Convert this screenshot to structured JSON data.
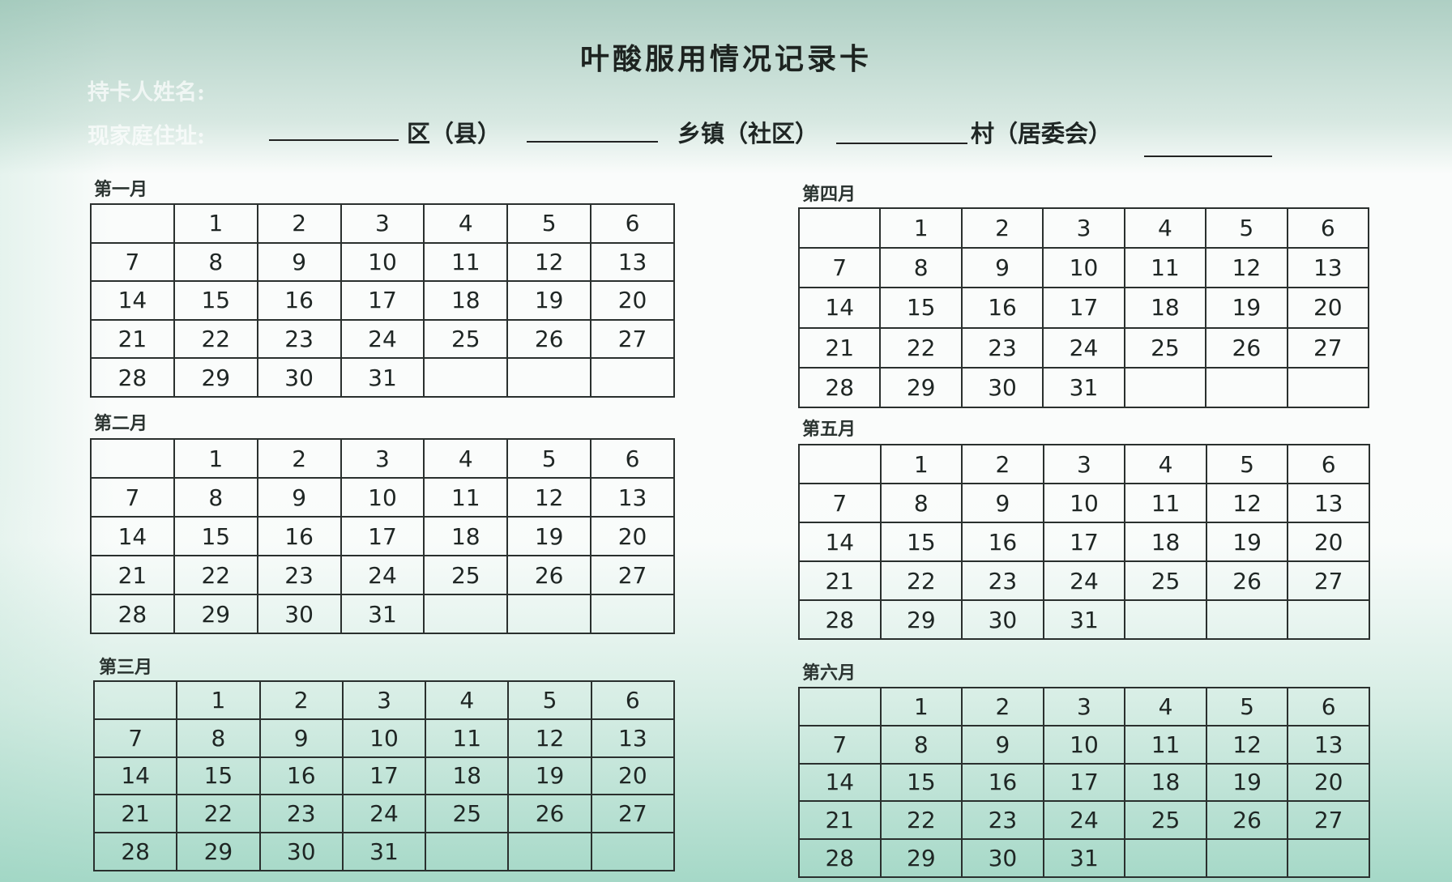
{
  "title": "叶酸服用情况记录卡",
  "holder_name_label": "持卡人姓名:",
  "address_label": "现家庭住址:",
  "address_parts": [
    "区（县）",
    "乡镇（社区）",
    "村（居委会）"
  ],
  "months": [
    {
      "label": "第一月",
      "rows": [
        [
          "",
          "1",
          "2",
          "3",
          "4",
          "5",
          "6"
        ],
        [
          "7",
          "8",
          "9",
          "10",
          "11",
          "12",
          "13"
        ],
        [
          "14",
          "15",
          "16",
          "17",
          "18",
          "19",
          "20"
        ],
        [
          "21",
          "22",
          "23",
          "24",
          "25",
          "26",
          "27"
        ],
        [
          "28",
          "29",
          "30",
          "31",
          "",
          "",
          ""
        ]
      ]
    },
    {
      "label": "第二月",
      "rows": [
        [
          "",
          "1",
          "2",
          "3",
          "4",
          "5",
          "6"
        ],
        [
          "7",
          "8",
          "9",
          "10",
          "11",
          "12",
          "13"
        ],
        [
          "14",
          "15",
          "16",
          "17",
          "18",
          "19",
          "20"
        ],
        [
          "21",
          "22",
          "23",
          "24",
          "25",
          "26",
          "27"
        ],
        [
          "28",
          "29",
          "30",
          "31",
          "",
          "",
          ""
        ]
      ]
    },
    {
      "label": "第三月",
      "rows": [
        [
          "",
          "1",
          "2",
          "3",
          "4",
          "5",
          "6"
        ],
        [
          "7",
          "8",
          "9",
          "10",
          "11",
          "12",
          "13"
        ],
        [
          "14",
          "15",
          "16",
          "17",
          "18",
          "19",
          "20"
        ],
        [
          "21",
          "22",
          "23",
          "24",
          "25",
          "26",
          "27"
        ],
        [
          "28",
          "29",
          "30",
          "31",
          "",
          "",
          ""
        ]
      ]
    },
    {
      "label": "第四月",
      "rows": [
        [
          "",
          "1",
          "2",
          "3",
          "4",
          "5",
          "6"
        ],
        [
          "7",
          "8",
          "9",
          "10",
          "11",
          "12",
          "13"
        ],
        [
          "14",
          "15",
          "16",
          "17",
          "18",
          "19",
          "20"
        ],
        [
          "21",
          "22",
          "23",
          "24",
          "25",
          "26",
          "27"
        ],
        [
          "28",
          "29",
          "30",
          "31",
          "",
          "",
          ""
        ]
      ]
    },
    {
      "label": "第五月",
      "rows": [
        [
          "",
          "1",
          "2",
          "3",
          "4",
          "5",
          "6"
        ],
        [
          "7",
          "8",
          "9",
          "10",
          "11",
          "12",
          "13"
        ],
        [
          "14",
          "15",
          "16",
          "17",
          "18",
          "19",
          "20"
        ],
        [
          "21",
          "22",
          "23",
          "24",
          "25",
          "26",
          "27"
        ],
        [
          "28",
          "29",
          "30",
          "31",
          "",
          "",
          ""
        ]
      ]
    },
    {
      "label": "第六月",
      "rows": [
        [
          "",
          "1",
          "2",
          "3",
          "4",
          "5",
          "6"
        ],
        [
          "7",
          "8",
          "9",
          "10",
          "11",
          "12",
          "13"
        ],
        [
          "14",
          "15",
          "16",
          "17",
          "18",
          "19",
          "20"
        ],
        [
          "21",
          "22",
          "23",
          "24",
          "25",
          "26",
          "27"
        ],
        [
          "28",
          "29",
          "30",
          "31",
          "",
          "",
          ""
        ]
      ]
    }
  ]
}
